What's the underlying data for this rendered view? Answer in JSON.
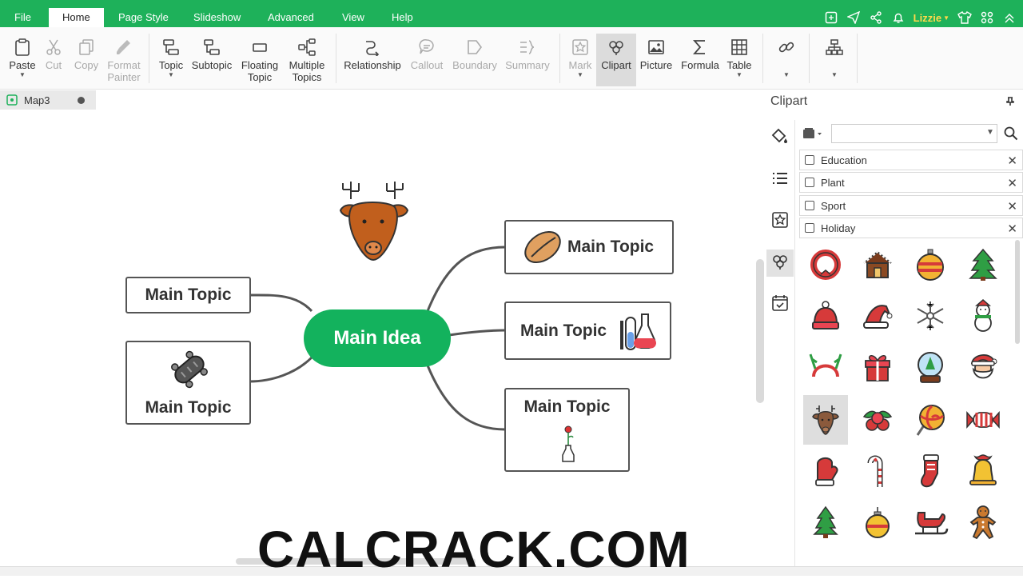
{
  "menubar": {
    "items": [
      "File",
      "Home",
      "Page Style",
      "Slideshow",
      "Advanced",
      "View",
      "Help"
    ],
    "active": "Home",
    "user": "Lizzie"
  },
  "ribbon": {
    "paste": "Paste",
    "cut": "Cut",
    "copy": "Copy",
    "format_painter_1": "Format",
    "format_painter_2": "Painter",
    "topic": "Topic",
    "subtopic": "Subtopic",
    "floating_1": "Floating",
    "floating_2": "Topic",
    "multiple_1": "Multiple",
    "multiple_2": "Topics",
    "relationship": "Relationship",
    "callout": "Callout",
    "boundary": "Boundary",
    "summary": "Summary",
    "mark": "Mark",
    "clipart": "Clipart",
    "picture": "Picture",
    "formula": "Formula",
    "table": "Table"
  },
  "document": {
    "tab_name": "Map3"
  },
  "mindmap": {
    "main_idea": "Main Idea",
    "topics": [
      "Main Topic",
      "Main Topic",
      "Main Topic",
      "Main Topic",
      "Main Topic"
    ]
  },
  "panel": {
    "title": "Clipart",
    "search": {
      "value": ""
    },
    "categories": [
      "Education",
      "Plant",
      "Sport",
      "Holiday"
    ],
    "cliparts": [
      "wreath-icon",
      "gingerbread-house-icon",
      "ornament-ball-icon",
      "christmas-tree-icon",
      "winter-hat-icon",
      "santa-hat-icon",
      "snowflake-icon",
      "snowman-icon",
      "reindeer-headband-icon",
      "gift-box-icon",
      "snow-globe-icon",
      "santa-face-icon",
      "reindeer-icon",
      "holly-berries-icon",
      "lollipop-icon",
      "candy-icon",
      "mitten-icon",
      "candy-cane-icon",
      "stocking-icon",
      "bell-icon",
      "small-tree-icon",
      "gold-ornament-icon",
      "sleigh-icon",
      "gingerbread-man-icon"
    ],
    "selected_clipart": "reindeer-icon"
  },
  "watermark": "CALCRACK.COM",
  "colors": {
    "brand_green": "#1eb15a",
    "main_idea": "#13b25d",
    "user_name": "#ffd94a"
  }
}
